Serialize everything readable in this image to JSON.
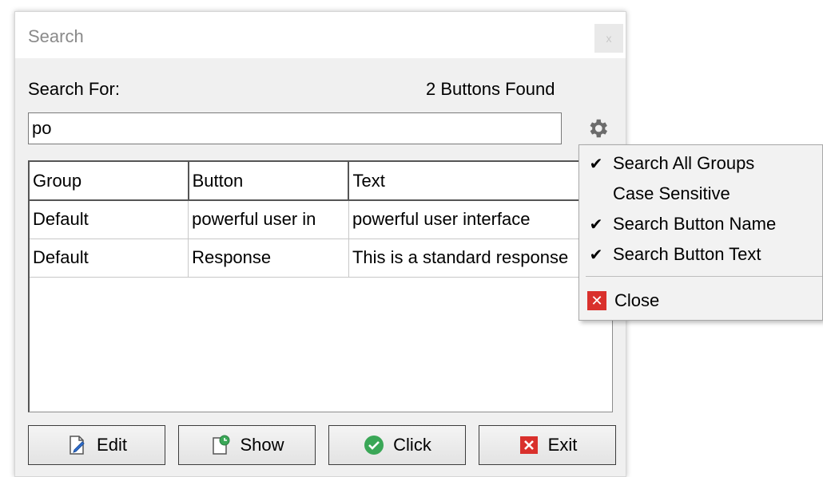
{
  "window": {
    "title": "Search",
    "close_glyph": "x"
  },
  "search": {
    "label": "Search For:",
    "results_count": "2 Buttons Found",
    "query": "po"
  },
  "grid": {
    "columns": [
      "Group",
      "Button",
      "Text"
    ],
    "rows": [
      [
        "Default",
        "powerful user in",
        "powerful user interface"
      ],
      [
        "Default",
        "Response",
        "This is a standard response"
      ]
    ]
  },
  "buttons": {
    "edit": "Edit",
    "show": "Show",
    "click": "Click",
    "exit": "Exit"
  },
  "options_menu": {
    "items": [
      {
        "label": "Search All Groups",
        "checked": true
      },
      {
        "label": "Case Sensitive",
        "checked": false
      },
      {
        "label": "Search Button Name",
        "checked": true
      },
      {
        "label": "Search Button Text",
        "checked": true
      }
    ],
    "close_label": "Close"
  },
  "icons": {
    "settings": "gear-icon",
    "edit": "edit-document-icon",
    "show": "show-document-icon",
    "click": "check-circle-icon",
    "exit": "close-red-icon",
    "check": "✔"
  },
  "colors": {
    "accent_red": "#d9302c",
    "accent_green": "#3aa757",
    "window_bg": "#f0f0f0"
  }
}
